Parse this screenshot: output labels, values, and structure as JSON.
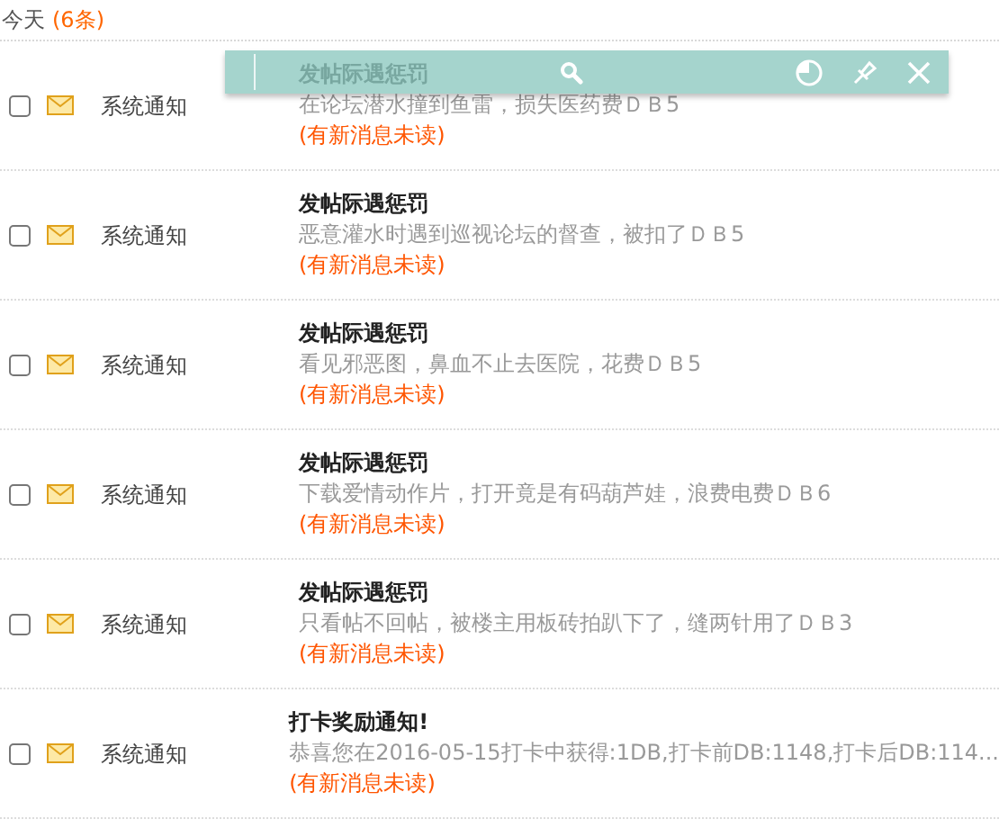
{
  "header": {
    "title": "今天",
    "count": "(6条)"
  },
  "messages": [
    {
      "checked": false,
      "unread": true,
      "sender": "系统通知",
      "title": "发帖际遇惩罚",
      "body": "在论坛潜水撞到鱼雷，损失医药费ＤＢ5",
      "status": "(有新消息未读)"
    },
    {
      "checked": false,
      "unread": true,
      "sender": "系统通知",
      "title": "发帖际遇惩罚",
      "body": "恶意灌水时遇到巡视论坛的督查，被扣了ＤＢ5",
      "status": "(有新消息未读)"
    },
    {
      "checked": false,
      "unread": true,
      "sender": "系统通知",
      "title": "发帖际遇惩罚",
      "body": "看见邪恶图，鼻血不止去医院，花费ＤＢ5",
      "status": "(有新消息未读)"
    },
    {
      "checked": false,
      "unread": true,
      "sender": "系统通知",
      "title": "发帖际遇惩罚",
      "body": "下载爱情动作片，打开竟是有码葫芦娃，浪费电费ＤＢ6",
      "status": "(有新消息未读)"
    },
    {
      "checked": false,
      "unread": true,
      "sender": "系统通知",
      "title": "发帖际遇惩罚",
      "body": "只看帖不回帖，被楼主用板砖拍趴下了，缝两针用了ＤＢ3",
      "status": "(有新消息未读)"
    },
    {
      "checked": false,
      "unread": true,
      "sender": "系统通知",
      "title": "打卡奖励通知!",
      "body": "恭喜您在2016-05-15打卡中获得:1DB,打卡前DB:1148,打卡后DB:114...",
      "status": "(有新消息未读)"
    }
  ]
}
